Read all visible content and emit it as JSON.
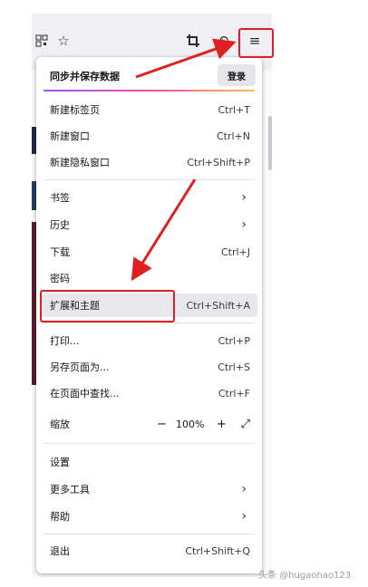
{
  "toolbar": {
    "icons": [
      "qr-code-icon",
      "star-icon",
      "crop-icon",
      "back-arrow-icon",
      "hamburger-menu-icon"
    ]
  },
  "menu": {
    "sync": {
      "title": "同步并保存数据",
      "login_label": "登录"
    },
    "items": [
      {
        "label": "新建标签页",
        "shortcut": "Ctrl+T"
      },
      {
        "label": "新建窗口",
        "shortcut": "Ctrl+N"
      },
      {
        "label": "新建隐私窗口",
        "shortcut": "Ctrl+Shift+P"
      },
      {
        "label": "书签",
        "shortcut": ""
      },
      {
        "label": "历史",
        "shortcut": ""
      },
      {
        "label": "下载",
        "shortcut": "Ctrl+J"
      },
      {
        "label": "密码",
        "shortcut": ""
      },
      {
        "label": "扩展和主题",
        "shortcut": "Ctrl+Shift+A"
      },
      {
        "label": "打印...",
        "shortcut": "Ctrl+P"
      },
      {
        "label": "另存页面为...",
        "shortcut": "Ctrl+S"
      },
      {
        "label": "在页面中查找...",
        "shortcut": "Ctrl+F"
      },
      {
        "label": "缩放",
        "shortcut": ""
      },
      {
        "label": "设置",
        "shortcut": ""
      },
      {
        "label": "更多工具",
        "shortcut": ""
      },
      {
        "label": "帮助",
        "shortcut": ""
      },
      {
        "label": "退出",
        "shortcut": "Ctrl+Shift+Q"
      }
    ],
    "zoom": {
      "minus": "−",
      "value": "100%",
      "plus": "+"
    }
  },
  "colors": {
    "annotation_red": "#e02020",
    "highlight": "#e8e8ec"
  },
  "watermark": "头条 @hugaohao123"
}
